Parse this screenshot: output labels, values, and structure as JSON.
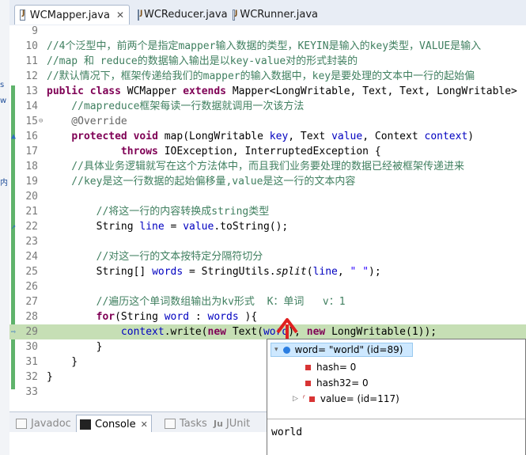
{
  "left_strip": [
    "s",
    "w",
    "内"
  ],
  "tabs": [
    {
      "label": "WCMapper.java",
      "active": true,
      "close": "✕"
    },
    {
      "label": "WCReducer.java",
      "active": false
    },
    {
      "label": "WCRunner.java",
      "active": false
    }
  ],
  "lines": [
    {
      "n": "9",
      "tokens": []
    },
    {
      "n": "10",
      "tokens": [
        {
          "t": "//4个泛型中，前两个是指定mapper输入数据的类型，KEYIN是输入的key类型，VALUE是输入",
          "c": "cm"
        }
      ]
    },
    {
      "n": "11",
      "tokens": [
        {
          "t": "//map 和 reduce的数据输入输出是以key-value对的形式封装的",
          "c": "cm"
        }
      ]
    },
    {
      "n": "12",
      "tokens": [
        {
          "t": "//默认情况下，框架传递给我们的mapper的输入数据中，key是要处理的文本中一行的起始偏",
          "c": "cm"
        }
      ]
    },
    {
      "n": "13",
      "tokens": [
        {
          "t": "public ",
          "c": "kw"
        },
        {
          "t": "class ",
          "c": "kw"
        },
        {
          "t": "WCMapper "
        },
        {
          "t": "extends ",
          "c": "kw"
        },
        {
          "t": "Mapper<LongWritable, Text, Text, LongWritable>"
        }
      ]
    },
    {
      "n": "14",
      "tokens": [
        {
          "t": "    //mapreduce框架每读一行数据就调用一次该方法",
          "c": "cm"
        }
      ]
    },
    {
      "n": "15",
      "fold": "⊖",
      "tokens": [
        {
          "t": "    @Override",
          "c": "an"
        }
      ]
    },
    {
      "n": "16",
      "bp": "▲",
      "tokens": [
        {
          "t": "    "
        },
        {
          "t": "protected ",
          "c": "kw"
        },
        {
          "t": "void ",
          "c": "kw"
        },
        {
          "t": "map(LongWritable "
        },
        {
          "t": "key",
          "c": "fld"
        },
        {
          "t": ", Text "
        },
        {
          "t": "value",
          "c": "fld"
        },
        {
          "t": ", Context "
        },
        {
          "t": "context",
          "c": "fld"
        },
        {
          "t": ")"
        }
      ]
    },
    {
      "n": "17",
      "tokens": [
        {
          "t": "            "
        },
        {
          "t": "throws ",
          "c": "kw"
        },
        {
          "t": "IOException, InterruptedException {"
        }
      ]
    },
    {
      "n": "18",
      "tokens": [
        {
          "t": "    //具体业务逻辑就写在这个方法体中，而且我们业务要处理的数据已经被框架传递进来",
          "c": "cm"
        }
      ]
    },
    {
      "n": "19",
      "tokens": [
        {
          "t": "    //key是这一行数据的起始偏移量,value是这一行的文本内容",
          "c": "cm"
        }
      ]
    },
    {
      "n": "20",
      "tokens": []
    },
    {
      "n": "21",
      "tokens": [
        {
          "t": "        //将这一行的内容转换成string类型",
          "c": "cm"
        }
      ]
    },
    {
      "n": "22",
      "bp": "↗",
      "tokens": [
        {
          "t": "        String "
        },
        {
          "t": "line",
          "c": "fld"
        },
        {
          "t": " = "
        },
        {
          "t": "value",
          "c": "fld"
        },
        {
          "t": ".toString();"
        }
      ]
    },
    {
      "n": "23",
      "tokens": []
    },
    {
      "n": "24",
      "tokens": [
        {
          "t": "        //对这一行的文本按特定分隔符切分",
          "c": "cm"
        }
      ]
    },
    {
      "n": "25",
      "tokens": [
        {
          "t": "        String[] "
        },
        {
          "t": "words",
          "c": "fld"
        },
        {
          "t": " = StringUtils."
        },
        {
          "t": "split",
          "c": "it"
        },
        {
          "t": "("
        },
        {
          "t": "line",
          "c": "fld"
        },
        {
          "t": ", "
        },
        {
          "t": "\" \"",
          "c": "st"
        },
        {
          "t": ");"
        }
      ]
    },
    {
      "n": "26",
      "tokens": []
    },
    {
      "n": "27",
      "tokens": [
        {
          "t": "        //遍历这个单词数组输出为kv形式  K：单词   v：1",
          "c": "cm"
        }
      ]
    },
    {
      "n": "28",
      "tokens": [
        {
          "t": "        "
        },
        {
          "t": "for",
          "c": "kw"
        },
        {
          "t": "(String "
        },
        {
          "t": "word",
          "c": "fld"
        },
        {
          "t": " : "
        },
        {
          "t": "words",
          "c": "fld"
        },
        {
          "t": " ){"
        }
      ]
    },
    {
      "n": "29",
      "hl": true,
      "bp": "⇨",
      "tokens": [
        {
          "t": "            "
        },
        {
          "t": "context",
          "c": "fld"
        },
        {
          "t": ".write("
        },
        {
          "t": "new ",
          "c": "kw"
        },
        {
          "t": "Text("
        },
        {
          "t": "word",
          "c": "fld"
        },
        {
          "t": "), "
        },
        {
          "t": "new ",
          "c": "kw"
        },
        {
          "t": "LongWritable(1));"
        }
      ]
    },
    {
      "n": "30",
      "tokens": [
        {
          "t": "        }"
        }
      ]
    },
    {
      "n": "31",
      "tokens": [
        {
          "t": "    }"
        }
      ]
    },
    {
      "n": "32",
      "tokens": [
        {
          "t": "}"
        }
      ]
    },
    {
      "n": "33",
      "tokens": []
    }
  ],
  "bottom_tabs": [
    {
      "label": "Javadoc",
      "active": false
    },
    {
      "label": "Console",
      "active": true,
      "close": "✕"
    },
    {
      "label": "Tasks",
      "active": false
    },
    {
      "label": "JUnit",
      "active": false,
      "prefix": "Ju"
    }
  ],
  "hover": {
    "root": "word= \"world\" (id=89)",
    "children": [
      "hash= 0",
      "hash32= 0",
      "value= (id=117)"
    ],
    "detail": "world"
  },
  "colors": {
    "highlight_line": "#c6dfb5",
    "arrow": "#e02020",
    "comment": "#3f7f5f",
    "keyword": "#7f0055"
  }
}
